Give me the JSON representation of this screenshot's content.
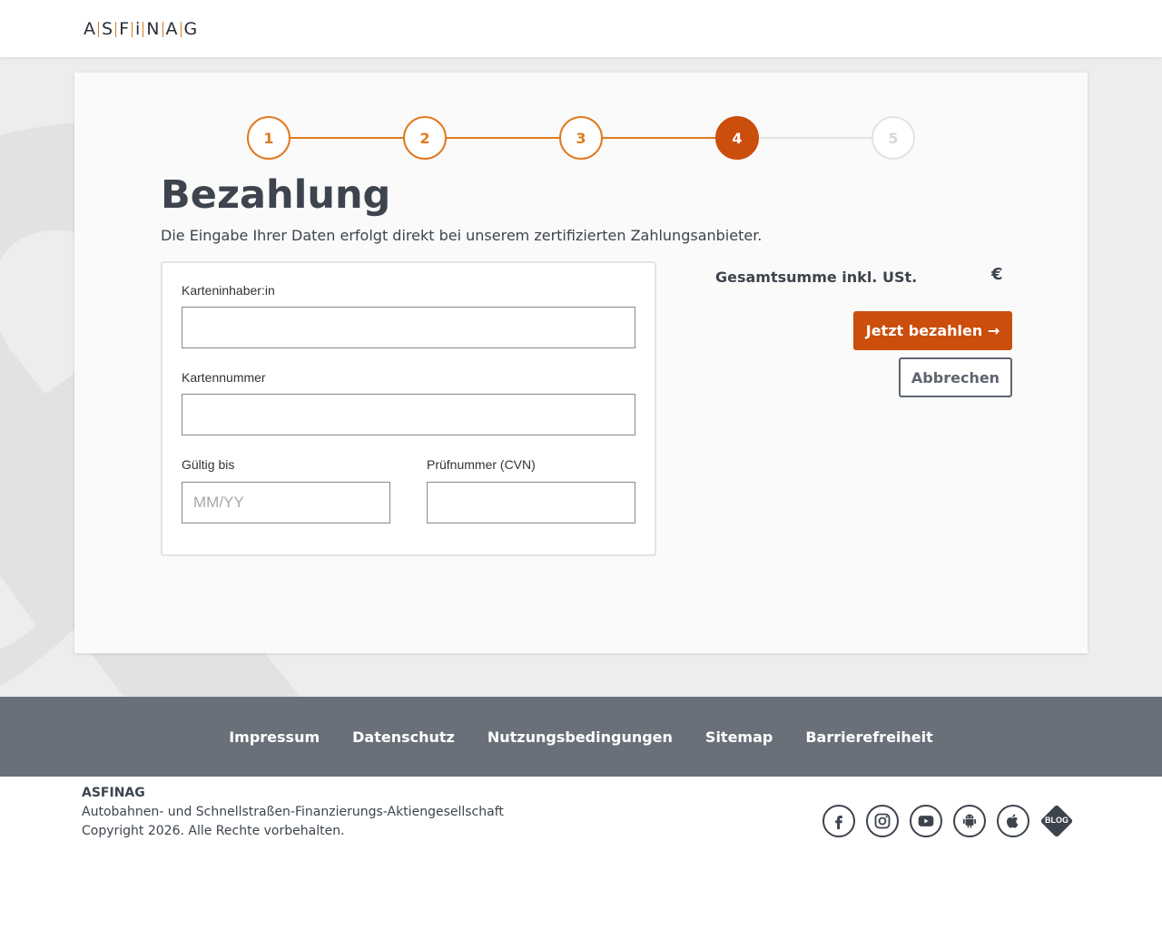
{
  "header": {
    "logo_letters": [
      "A",
      "S",
      "F",
      "i",
      "N",
      "A",
      "G"
    ],
    "logo_separator_colors": [
      "#e07a1f",
      "#e07a1f",
      "#e07a1f",
      "#e07a1f",
      "#e07a1f",
      "#e07a1f"
    ]
  },
  "stepper": {
    "steps": [
      {
        "label": "1",
        "state": "done"
      },
      {
        "label": "2",
        "state": "done"
      },
      {
        "label": "3",
        "state": "done"
      },
      {
        "label": "4",
        "state": "active"
      },
      {
        "label": "5",
        "state": "todo"
      }
    ],
    "accent_color": "#e07a1f",
    "active_color": "#cc4e0c"
  },
  "page": {
    "title": "Bezahlung",
    "subtitle": "Die Eingabe Ihrer Daten erfolgt direkt bei unserem zertifizierten Zahlungsanbieter."
  },
  "form": {
    "cardholder_label": "Karteninhaber:in",
    "cardholder_value": "",
    "cardnumber_label": "Kartennummer",
    "cardnumber_value": "",
    "expiry_label": "Gültig bis",
    "expiry_placeholder": "MM/YY",
    "cvn_label": "Prüfnummer (CVN)",
    "cvn_value": ""
  },
  "summary": {
    "total_label": "Gesamtsumme inkl. USt.",
    "total_value": "€",
    "pay_button": "Jetzt bezahlen →",
    "cancel_button": "Abbrechen"
  },
  "footer": {
    "links": [
      "Impressum",
      "Datenschutz",
      "Nutzungsbedingungen",
      "Sitemap",
      "Barrierefreiheit"
    ],
    "company": "ASFINAG",
    "company_full": "Autobahnen- und Schnellstraßen-Finanzierungs-Aktiengesellschaft",
    "copyright": "Copyright 2026. Alle Rechte vorbehalten.",
    "social_icons": [
      "facebook-icon",
      "instagram-icon",
      "youtube-icon",
      "android-icon",
      "apple-icon",
      "blog-icon"
    ],
    "blog_label": "BLOG"
  },
  "colors": {
    "brand_orange": "#cc4e0c",
    "footer_gray": "#6a7079",
    "text_dark": "#3d444d"
  }
}
